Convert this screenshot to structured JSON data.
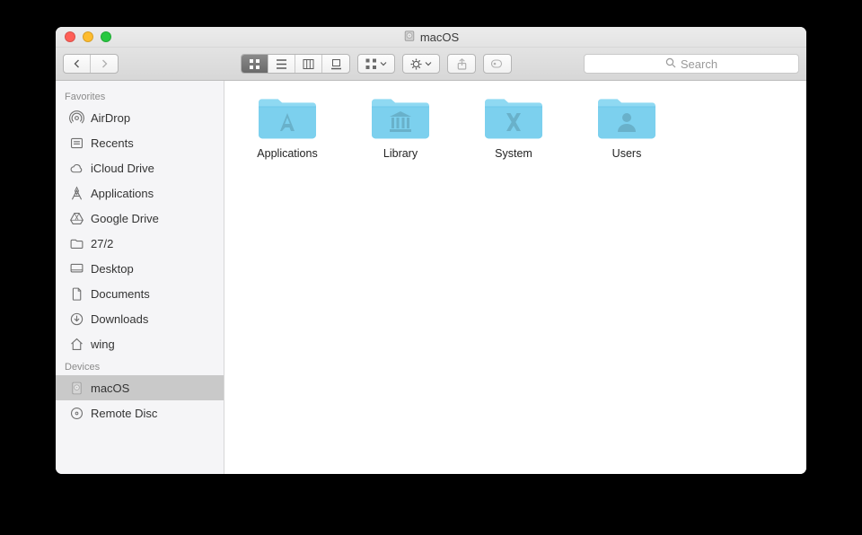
{
  "window_title": "macOS",
  "search_placeholder": "Search",
  "colors": {
    "folder_top": "#8fd9f2",
    "folder_body": "#7cd0ee",
    "folder_body2": "#6ec8ea"
  },
  "sidebar": {
    "sections": [
      {
        "header": "Favorites",
        "items": [
          {
            "label": "AirDrop",
            "icon": "airdrop"
          },
          {
            "label": "Recents",
            "icon": "recents"
          },
          {
            "label": "iCloud Drive",
            "icon": "icloud"
          },
          {
            "label": "Applications",
            "icon": "applications"
          },
          {
            "label": "Google Drive",
            "icon": "googledrive"
          },
          {
            "label": "27/2",
            "icon": "folder"
          },
          {
            "label": "Desktop",
            "icon": "desktop"
          },
          {
            "label": "Documents",
            "icon": "documents"
          },
          {
            "label": "Downloads",
            "icon": "downloads"
          },
          {
            "label": "wing",
            "icon": "home"
          }
        ]
      },
      {
        "header": "Devices",
        "items": [
          {
            "label": "macOS",
            "icon": "hdd",
            "selected": true
          },
          {
            "label": "Remote Disc",
            "icon": "disc"
          }
        ]
      }
    ]
  },
  "folders": [
    {
      "label": "Applications",
      "glyph": "A"
    },
    {
      "label": "Library",
      "glyph": "library"
    },
    {
      "label": "System",
      "glyph": "X"
    },
    {
      "label": "Users",
      "glyph": "user"
    }
  ]
}
